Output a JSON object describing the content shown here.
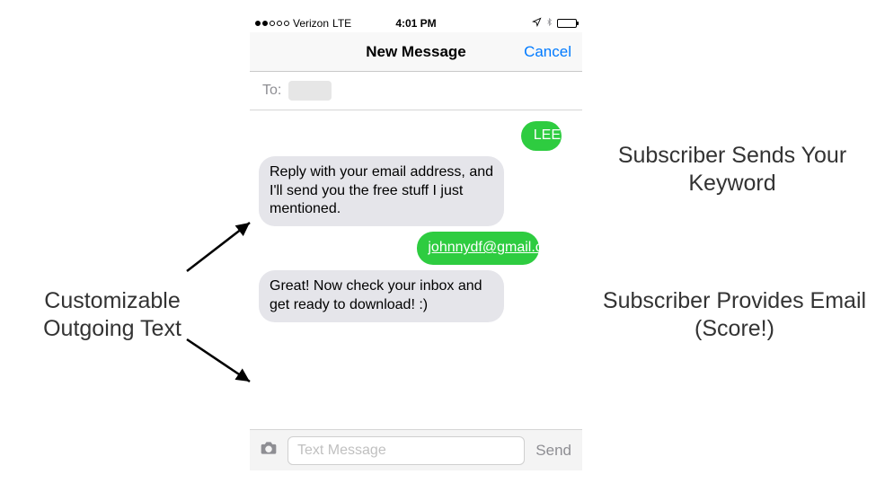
{
  "statusbar": {
    "carrier": "Verizon",
    "network": "LTE",
    "time": "4:01 PM"
  },
  "nav": {
    "title": "New Message",
    "cancel": "Cancel"
  },
  "to": {
    "label": "To:"
  },
  "messages": {
    "m1": "LEE",
    "m2": "Reply with your email address, and I'll send you the free stuff I just mentioned.",
    "m3": "johnnydf@gmail.com",
    "m4": "Great!  Now check your inbox and get ready to download! :)"
  },
  "compose": {
    "placeholder": "Text Message",
    "send": "Send"
  },
  "annotations": {
    "left": "Customizable Outgoing Text",
    "right1": "Subscriber Sends Your Keyword",
    "right2": "Subscriber Provides Email (Score!)"
  }
}
